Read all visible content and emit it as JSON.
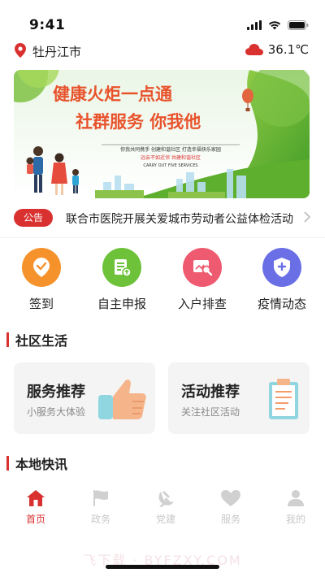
{
  "status": {
    "time": "9:41"
  },
  "location": {
    "city": "牡丹江市",
    "temperature": "36.1℃"
  },
  "banner": {
    "headline1": "健康火炬一点通",
    "headline2": "社群服务 你我他",
    "tagline1": "你我共同携手 创建和谐社区 打造幸福快乐家园",
    "tagline2": "远亲不如近邻   共建和谐社区",
    "tagline3": "CARRY OUT FIVE SERVICES"
  },
  "notice": {
    "badge": "公告",
    "text": "联合市医院开展关爱城市劳动者公益体检活动"
  },
  "quick_actions": [
    {
      "label": "签到",
      "icon": "check-in-icon",
      "color": "#f5922b"
    },
    {
      "label": "自主申报",
      "icon": "report-icon",
      "color": "#6dc23a"
    },
    {
      "label": "入户排查",
      "icon": "inspection-icon",
      "color": "#ee5a6f"
    },
    {
      "label": "疫情动态",
      "icon": "shield-plus-icon",
      "color": "#6a6fe6"
    }
  ],
  "sections": {
    "community": "社区生活",
    "news": "本地快讯"
  },
  "cards": [
    {
      "title": "服务推荐",
      "subtitle": "小服务大体验",
      "icon": "thumbs-up-icon"
    },
    {
      "title": "活动推荐",
      "subtitle": "关注社区活动",
      "icon": "clipboard-icon"
    }
  ],
  "tabs": [
    {
      "label": "首页",
      "icon": "home-icon",
      "active": true
    },
    {
      "label": "政务",
      "icon": "flag-icon",
      "active": false
    },
    {
      "label": "党建",
      "icon": "party-emblem-icon",
      "active": false
    },
    {
      "label": "服务",
      "icon": "heart-icon",
      "active": false
    },
    {
      "label": "我的",
      "icon": "user-icon",
      "active": false
    }
  ],
  "watermark": "飞下载 · BYFZXY.COM",
  "colors": {
    "accent": "#d93030",
    "inactive": "#c8c8c8"
  }
}
